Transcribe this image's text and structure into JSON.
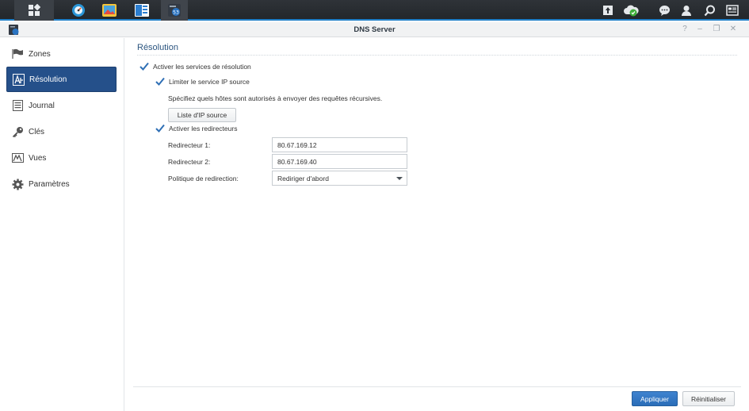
{
  "taskbar": {
    "apps": [
      "main-menu-icon",
      "resource-monitor-icon",
      "photo-station-icon",
      "package-center-icon",
      "dns-server-icon"
    ],
    "right_icons": [
      "upload-icon",
      "cloud-sync-icon",
      "chat-icon",
      "user-icon",
      "search-icon",
      "widgets-icon"
    ]
  },
  "window": {
    "title": "DNS Server",
    "controls": {
      "help": "?",
      "minimize": "–",
      "restore": "❐",
      "close": "✕"
    }
  },
  "sidebar": {
    "items": [
      {
        "label": "Zones",
        "icon": "flag-icon",
        "active": false
      },
      {
        "label": "Résolution",
        "icon": "resolution-icon",
        "active": true
      },
      {
        "label": "Journal",
        "icon": "log-icon",
        "active": false
      },
      {
        "label": "Clés",
        "icon": "key-icon",
        "active": false
      },
      {
        "label": "Vues",
        "icon": "views-icon",
        "active": false
      },
      {
        "label": "Paramètres",
        "icon": "gear-icon",
        "active": false
      }
    ]
  },
  "main": {
    "section_title": "Résolution",
    "enable_resolution": {
      "label": "Activer les services de résolution",
      "checked": true
    },
    "limit_source_ip": {
      "label": "Limiter le service IP source",
      "checked": true
    },
    "hint": "Spécifiez quels hôtes sont autorisés à envoyer des requêtes récursives.",
    "ip_list_button": "Liste d'IP source",
    "enable_forwarders": {
      "label": "Activer les redirecteurs",
      "checked": true
    },
    "forwarder1": {
      "label": "Redirecteur 1:",
      "value": "80.67.169.12"
    },
    "forwarder2": {
      "label": "Redirecteur 2:",
      "value": "80.67.169.40"
    },
    "policy": {
      "label": "Politique de redirection:",
      "value": "Rediriger d'abord"
    }
  },
  "footer": {
    "apply": "Appliquer",
    "reset": "Réinitialiser"
  },
  "colors": {
    "accent": "#25508a",
    "apply": "#2f74c0",
    "taskbar": "#2a2e33",
    "section_title": "#2d5680"
  }
}
